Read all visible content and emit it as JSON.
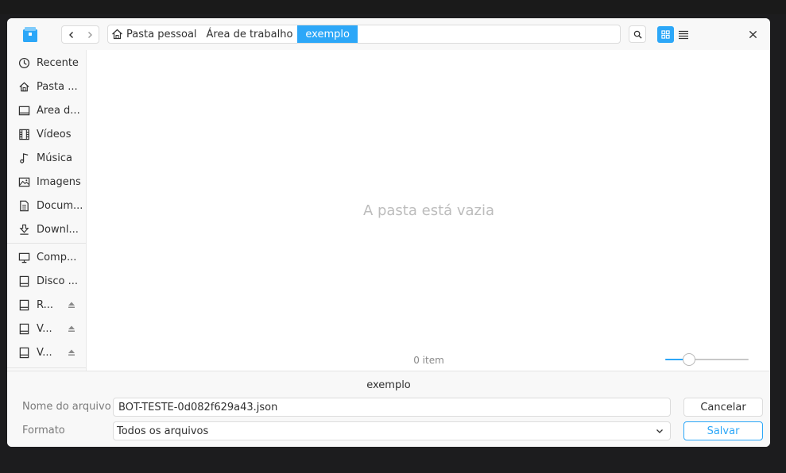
{
  "header": {
    "breadcrumbs": [
      "Pasta pessoal",
      "Área de trabalho",
      "exemplo"
    ],
    "icons": {
      "app": "file-manager-icon",
      "back": "chevron-left-icon",
      "forward": "chevron-right-icon",
      "search": "search-icon",
      "grid_view": "grid-view-icon",
      "list_view": "list-view-icon",
      "close": "close-icon"
    }
  },
  "sidebar": {
    "items": [
      {
        "label": "Recente",
        "icon": "clock-icon"
      },
      {
        "label": "Pasta ...",
        "icon": "home-icon"
      },
      {
        "label": "Área d...",
        "icon": "desktop-icon"
      },
      {
        "label": "Vídeos",
        "icon": "video-icon"
      },
      {
        "label": "Música",
        "icon": "music-icon"
      },
      {
        "label": "Imagens",
        "icon": "image-icon"
      },
      {
        "label": "Docum...",
        "icon": "document-icon"
      },
      {
        "label": "Downl...",
        "icon": "download-icon"
      },
      {
        "label": "Comp...",
        "icon": "computer-icon"
      },
      {
        "label": "Disco ...",
        "icon": "disk-icon"
      },
      {
        "label": "R...",
        "icon": "disk-icon",
        "eject": true
      },
      {
        "label": "V...",
        "icon": "disk-icon",
        "eject": true
      },
      {
        "label": "V...",
        "icon": "disk-icon",
        "eject": true
      }
    ]
  },
  "main": {
    "empty_message": "A pasta está vazia",
    "item_count": "0 item",
    "icon_size_level": 0.25
  },
  "footer": {
    "current_folder": "exemplo",
    "filename_label": "Nome do arquivo",
    "filename_value": "BOT-TESTE-0d082f629a43.json",
    "format_label": "Formato",
    "format_value": "Todos os arquivos",
    "cancel_label": "Cancelar",
    "save_label": "Salvar"
  },
  "colors": {
    "accent": "#2ca7f8",
    "background": "#1c1c1e"
  }
}
